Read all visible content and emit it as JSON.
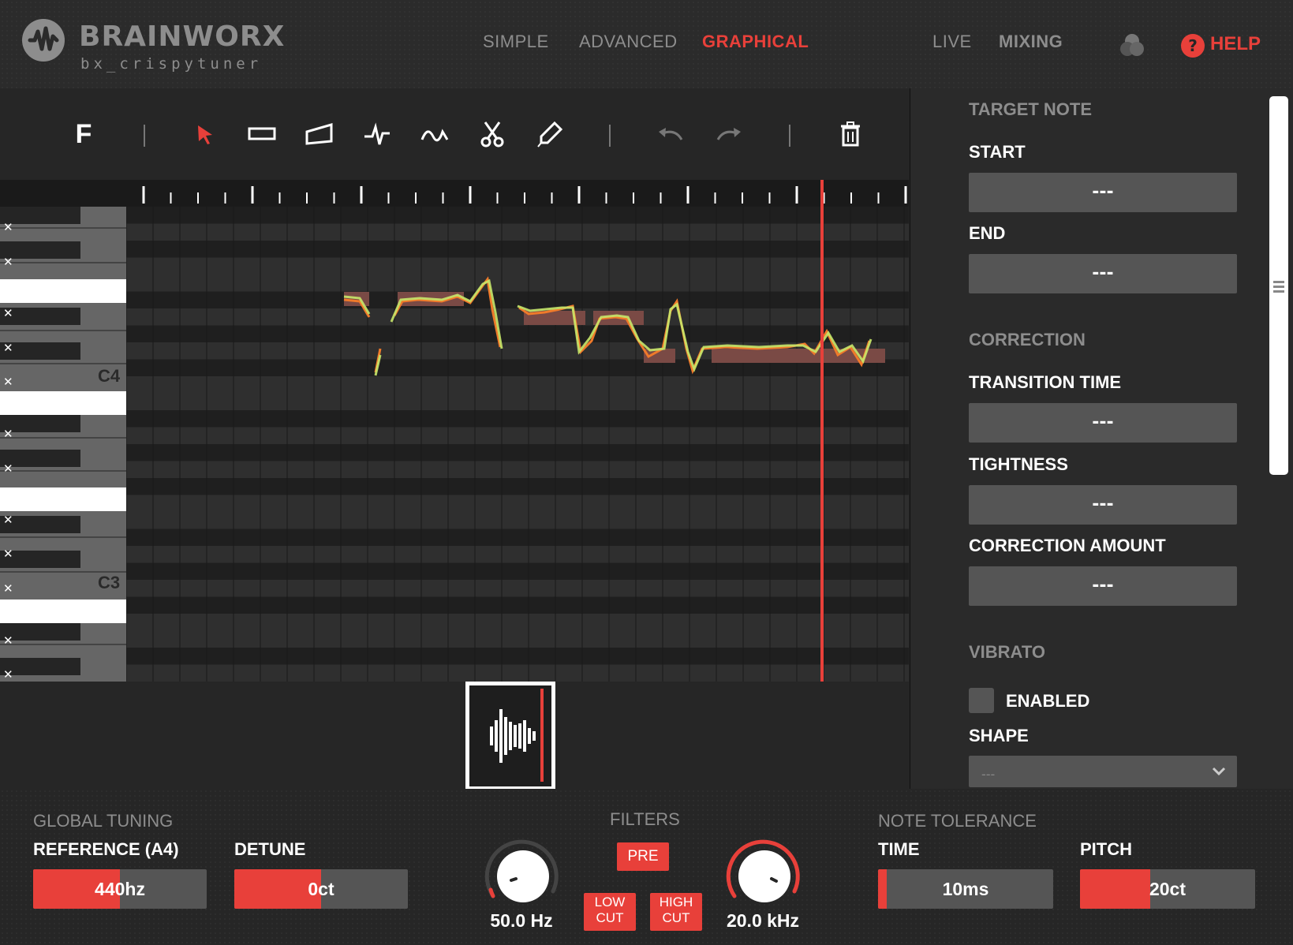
{
  "header": {
    "brand": "BRAINWORX",
    "product": "bx_crispytuner",
    "nav": {
      "simple": "SIMPLE",
      "advanced": "ADVANCED",
      "graphical": "GRAPHICAL",
      "live": "LIVE",
      "mixing": "MIXING"
    },
    "help_icon": "?",
    "help": "HELP"
  },
  "toolbar": {
    "f_label": "F",
    "tools": [
      "select-arrow-icon",
      "note-rect-icon",
      "slope-icon",
      "pitch-line-icon",
      "vibrato-wave-icon",
      "scissors-icon",
      "pencil-icon",
      "undo-icon",
      "redo-icon",
      "trash-icon"
    ]
  },
  "piano": {
    "c4": "C4",
    "c3": "C3",
    "mute_symbol": "✕"
  },
  "zoom": {
    "plus": "+",
    "minus": "-"
  },
  "panel": {
    "target_note": "TARGET NOTE",
    "start_label": "START",
    "start_value": "---",
    "end_label": "END",
    "end_value": "---",
    "correction": "CORRECTION",
    "transition_label": "TRANSITION TIME",
    "transition_value": "---",
    "tightness_label": "TIGHTNESS",
    "tightness_value": "---",
    "amount_label": "CORRECTION AMOUNT",
    "amount_value": "---",
    "vibrato": "VIBRATO",
    "enabled_label": "ENABLED",
    "shape_label": "SHAPE",
    "shape_value": "---"
  },
  "bottom": {
    "global_tuning": "GLOBAL TUNING",
    "reference_label": "REFERENCE (A4)",
    "reference_value": "440hz",
    "reference_fill": 0.5,
    "detune_label": "DETUNE",
    "detune_value": "0ct",
    "detune_fill": 0.5,
    "filters": "FILTERS",
    "pre": "PRE",
    "low_cut": "LOW\nCUT",
    "high_cut": "HIGH\nCUT",
    "low_cut_value": "50.0 Hz",
    "high_cut_value": "20.0 kHz",
    "note_tolerance": "NOTE TOLERANCE",
    "time_label": "TIME",
    "time_value": "10ms",
    "time_fill": 0.05,
    "pitch_label": "PITCH",
    "pitch_value": "20ct",
    "pitch_fill": 0.4
  },
  "colors": {
    "accent": "#e8403a",
    "detected_pitch": "#f07a2a",
    "corrected_pitch": "#c8e86a",
    "note_block": "#7a4a45"
  }
}
